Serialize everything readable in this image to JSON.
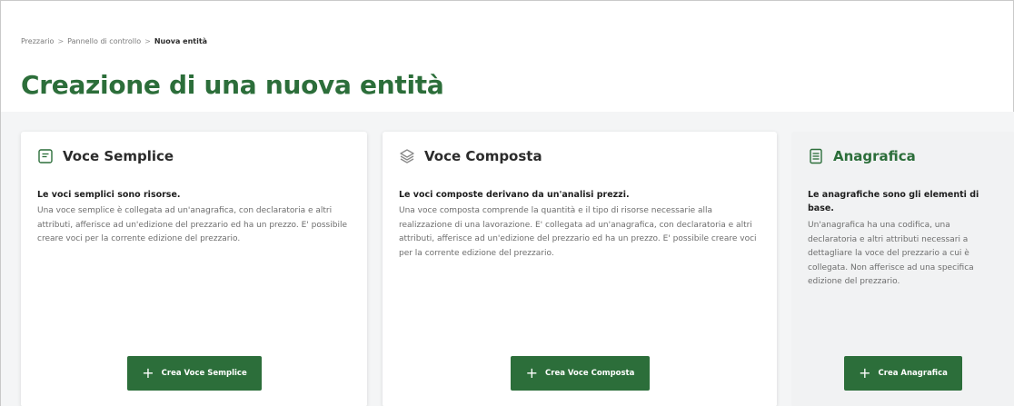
{
  "breadcrumb": {
    "items": [
      "Prezzario",
      "Pannello di controllo",
      "Nuova entità"
    ],
    "separator": ">"
  },
  "page": {
    "title": "Creazione di una nuova entità"
  },
  "colors": {
    "brand_green": "#2c6e3a",
    "card_grey": "#f1f2f3"
  },
  "cards": [
    {
      "icon": "document-lines-icon",
      "title": "Voce Semplice",
      "lead": "Le voci semplici sono risorse.",
      "body": "Una voce semplice è collegata ad un'anagrafica, con declaratoria e altri attributi, afferisce ad un'edizione del prezzario ed ha un prezzo. E' possibile creare voci per la corrente edizione del prezzario.",
      "button": "Crea Voce Semplice"
    },
    {
      "icon": "layers-icon",
      "title": "Voce Composta",
      "lead": "Le voci composte derivano da un'analisi prezzi.",
      "body": "Una voce composta comprende la quantità e il tipo di risorse necessarie alla realizzazione di una lavorazione. E' collegata ad un'anagrafica, con declaratoria e altri attributi, afferisce ad un'edizione del prezzario ed ha un prezzo. E' possibile creare voci per la corrente edizione del prezzario.",
      "button": "Crea Voce Composta"
    },
    {
      "icon": "list-document-icon",
      "title": "Anagrafica",
      "lead": "Le anagrafiche sono gli elementi di base.",
      "body": "Un'anagrafica ha una codifica, una declaratoria e altri attributi necessari a dettagliare la voce del prezzario a cui è collegata. Non afferisce ad una specifica edizione del prezzario.",
      "button": "Crea Anagrafica"
    }
  ]
}
